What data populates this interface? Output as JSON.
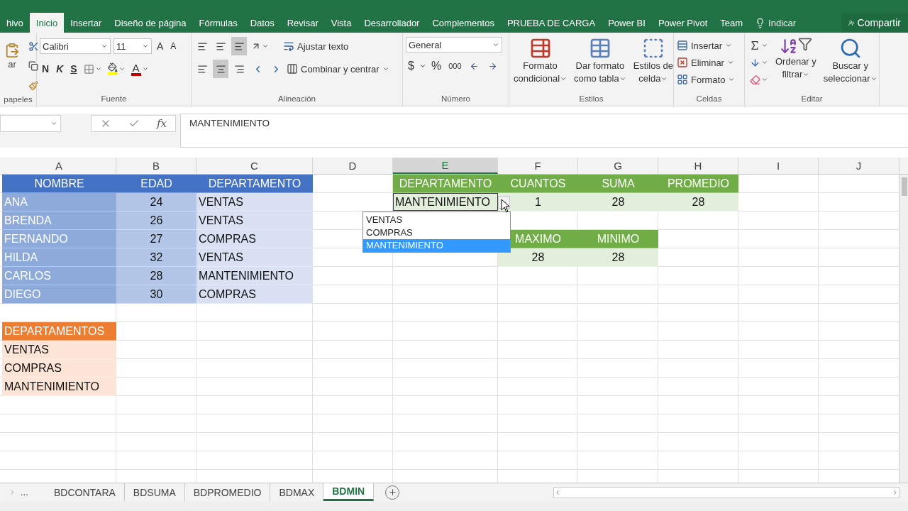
{
  "ribbon_tabs": [
    {
      "label": "hivo",
      "selected": false
    },
    {
      "label": "Inicio",
      "selected": true
    },
    {
      "label": "Insertar",
      "selected": false
    },
    {
      "label": "Diseño de página",
      "selected": false
    },
    {
      "label": "Fórmulas",
      "selected": false
    },
    {
      "label": "Datos",
      "selected": false
    },
    {
      "label": "Revisar",
      "selected": false
    },
    {
      "label": "Vista",
      "selected": false
    },
    {
      "label": "Desarrollador",
      "selected": false
    },
    {
      "label": "Complementos",
      "selected": false
    },
    {
      "label": "PRUEBA DE CARGA",
      "selected": false
    },
    {
      "label": "Power BI",
      "selected": false
    },
    {
      "label": "Power Pivot",
      "selected": false
    },
    {
      "label": "Team",
      "selected": false
    }
  ],
  "tell_me": "Indicar",
  "share": "Compartir",
  "clipboard": {
    "paste": "ar",
    "label": "papeles"
  },
  "font": {
    "name": "Calibri",
    "size": "11",
    "grow": "A",
    "shrink": "A",
    "bold": "N",
    "italic": "K",
    "underline": "S",
    "font_color_letter": "A",
    "label": "Fuente"
  },
  "alignment": {
    "vertical": [
      {
        "selected": false
      },
      {
        "selected": false
      },
      {
        "selected": true
      }
    ],
    "horizontal": [
      {
        "selected": false
      },
      {
        "selected": true
      },
      {
        "selected": false
      }
    ],
    "wrap": "Ajustar texto",
    "merge": "Combinar y centrar",
    "label": "Alineación"
  },
  "number": {
    "format": "General",
    "currency": "$",
    "percent": "%",
    "thousands": "000",
    "label": "Número"
  },
  "styles": {
    "buttons": [
      {
        "kind": "conditional",
        "lines": [
          "Formato",
          "condicional"
        ]
      },
      {
        "kind": "table",
        "lines": [
          "Dar formato",
          "como tabla"
        ]
      },
      {
        "kind": "cell",
        "lines": [
          "Estilos de",
          "celda"
        ]
      }
    ],
    "label": "Estilos"
  },
  "cells_group": {
    "items": [
      {
        "kind": "insert",
        "label": "Insertar"
      },
      {
        "kind": "delete",
        "label": "Eliminar"
      },
      {
        "kind": "format",
        "label": "Formato"
      }
    ],
    "label": "Celdas"
  },
  "editing": {
    "buttons": [
      {
        "kind": "sort",
        "lines": [
          "Ordenar y",
          "filtrar"
        ]
      },
      {
        "kind": "find",
        "lines": [
          "Buscar y",
          "seleccionar"
        ]
      }
    ],
    "label": "Editar"
  },
  "formula_bar": {
    "fx": "fx",
    "value": "MANTENIMIENTO"
  },
  "columns": [
    {
      "label": "A",
      "selected": false
    },
    {
      "label": "B",
      "selected": false
    },
    {
      "label": "C",
      "selected": false
    },
    {
      "label": "D",
      "selected": false
    },
    {
      "label": "E",
      "selected": true
    },
    {
      "label": "F",
      "selected": false
    },
    {
      "label": "G",
      "selected": false
    },
    {
      "label": "H",
      "selected": false
    },
    {
      "label": "I",
      "selected": false
    },
    {
      "label": "J",
      "selected": false
    }
  ],
  "tables": [
    {
      "kind": "employees",
      "columns": [
        "NOMBRE",
        "EDAD",
        "DEPARTAMENTO"
      ],
      "rows": [
        [
          "ANA",
          "24",
          "VENTAS"
        ],
        [
          "BRENDA",
          "26",
          "VENTAS"
        ],
        [
          "FERNANDO",
          "27",
          "COMPRAS"
        ],
        [
          "HILDA",
          "32",
          "VENTAS"
        ],
        [
          "CARLOS",
          "28",
          "MANTENIMIENTO"
        ],
        [
          "DIEGO",
          "30",
          "COMPRAS"
        ]
      ]
    },
    {
      "kind": "query",
      "columns": [
        "DEPARTAMENTO",
        "CUANTOS",
        "SUMA",
        "PROMEDIO"
      ],
      "rows": [
        [
          {
            "text": "MANTENIMIENTO",
            "selected": true
          },
          {
            "text": "1",
            "selected": false
          },
          {
            "text": "28",
            "selected": false
          },
          {
            "text": "28",
            "selected": false
          }
        ]
      ]
    },
    {
      "kind": "extremes",
      "columns": [
        "MAXIMO",
        "MINIMO"
      ],
      "rows": [
        [
          "28",
          "28"
        ]
      ]
    },
    {
      "kind": "list",
      "columns": [
        "DEPARTAMENTOS"
      ],
      "rows": [
        [
          "VENTAS"
        ],
        [
          "COMPRAS"
        ],
        [
          "MANTENIMIENTO"
        ]
      ]
    }
  ],
  "dropdown": {
    "options": [
      {
        "label": "VENTAS",
        "selected": false
      },
      {
        "label": "COMPRAS",
        "selected": false
      },
      {
        "label": "MANTENIMIENTO",
        "selected": true
      }
    ]
  },
  "more_tabs": "...",
  "sheet_tabs": [
    {
      "label": "BDCONTARA",
      "selected": false
    },
    {
      "label": "BDSUMA",
      "selected": false
    },
    {
      "label": "BDPROMEDIO",
      "selected": false
    },
    {
      "label": "BDMAX",
      "selected": false
    },
    {
      "label": "BDMIN",
      "selected": true
    }
  ]
}
